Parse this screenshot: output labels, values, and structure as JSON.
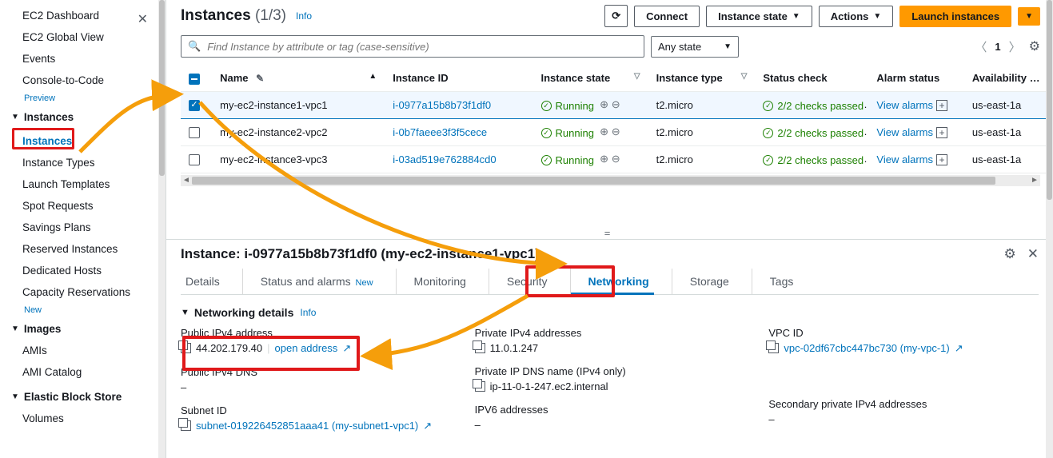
{
  "sidebar": {
    "top": [
      {
        "label": "EC2 Dashboard"
      },
      {
        "label": "EC2 Global View"
      },
      {
        "label": "Events"
      },
      {
        "label": "Console-to-Code"
      }
    ],
    "preview_badge": "Preview",
    "sections": [
      {
        "label": "Instances",
        "items": [
          {
            "label": "Instances",
            "selected": true
          },
          {
            "label": "Instance Types"
          },
          {
            "label": "Launch Templates"
          },
          {
            "label": "Spot Requests"
          },
          {
            "label": "Savings Plans"
          },
          {
            "label": "Reserved Instances"
          },
          {
            "label": "Dedicated Hosts"
          },
          {
            "label": "Capacity Reservations"
          }
        ],
        "new_badge": "New"
      },
      {
        "label": "Images",
        "items": [
          {
            "label": "AMIs"
          },
          {
            "label": "AMI Catalog"
          }
        ]
      },
      {
        "label": "Elastic Block Store",
        "items": [
          {
            "label": "Volumes"
          }
        ]
      }
    ]
  },
  "header": {
    "title": "Instances",
    "count": "(1/3)",
    "info": "Info",
    "refresh_icon": "↻",
    "connect": "Connect",
    "instance_state": "Instance state",
    "actions": "Actions",
    "launch": "Launch instances"
  },
  "filter": {
    "search_placeholder": "Find Instance by attribute or tag (case-sensitive)",
    "any_state": "Any state",
    "page": "1"
  },
  "table": {
    "columns": {
      "name": "Name",
      "instance_id": "Instance ID",
      "instance_state": "Instance state",
      "instance_type": "Instance type",
      "status_check": "Status check",
      "alarm_status": "Alarm status",
      "az": "Availability Zone"
    },
    "rows": [
      {
        "selected": true,
        "name": "my-ec2-instance1-vpc1",
        "id": "i-0977a15b8b73f1df0",
        "state": "Running",
        "type": "t2.micro",
        "check": "2/2 checks passed",
        "alarm": "View alarms",
        "az": "us-east-1a"
      },
      {
        "selected": false,
        "name": "my-ec2-instance2-vpc2",
        "id": "i-0b7faeee3f3f5cece",
        "state": "Running",
        "type": "t2.micro",
        "check": "2/2 checks passed",
        "alarm": "View alarms",
        "az": "us-east-1a"
      },
      {
        "selected": false,
        "name": "my-ec2-instance3-vpc3",
        "id": "i-03ad519e762884cd0",
        "state": "Running",
        "type": "t2.micro",
        "check": "2/2 checks passed",
        "alarm": "View alarms",
        "az": "us-east-1a"
      }
    ]
  },
  "detail": {
    "title": "Instance: i-0977a15b8b73f1df0 (my-ec2-instance1-vpc1)",
    "tabs": {
      "details": "Details",
      "status": "Status and alarms",
      "status_new": "New",
      "monitoring": "Monitoring",
      "security": "Security",
      "networking": "Networking",
      "storage": "Storage",
      "tags": "Tags"
    },
    "section_title": "Networking details",
    "section_info": "Info",
    "fields": {
      "pub_ip_lbl": "Public IPv4 address",
      "pub_ip_val": "44.202.179.40",
      "pub_ip_open": "open address",
      "pub_dns_lbl": "Public IPv4 DNS",
      "pub_dns_val": "–",
      "subnet_lbl": "Subnet ID",
      "subnet_val": "subnet-019226452851aaa41 (my-subnet1-vpc1)",
      "priv_ip_lbl": "Private IPv4 addresses",
      "priv_ip_val": "11.0.1.247",
      "priv_dns_lbl": "Private IP DNS name (IPv4 only)",
      "priv_dns_val": "ip-11-0-1-247.ec2.internal",
      "ipv6_lbl": "IPV6 addresses",
      "ipv6_val": "–",
      "vpc_lbl": "VPC ID",
      "vpc_val": "vpc-02df67cbc447bc730 (my-vpc-1)",
      "sec_priv_lbl": "Secondary private IPv4 addresses",
      "sec_priv_val": "–"
    }
  }
}
